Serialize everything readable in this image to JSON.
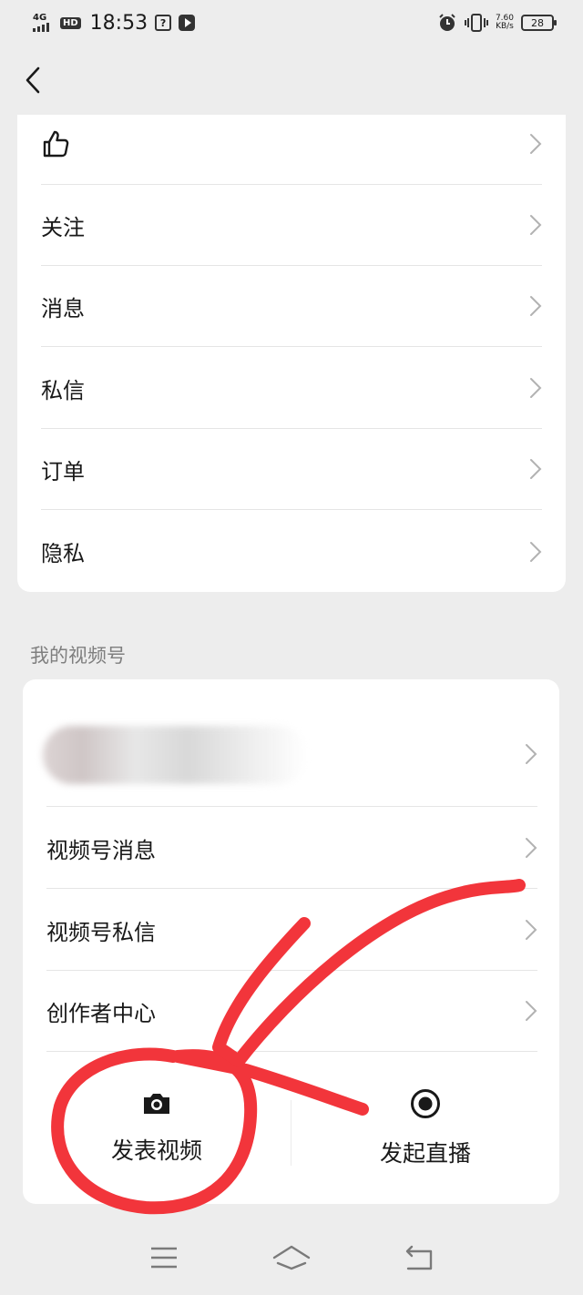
{
  "status_bar": {
    "network": "4G",
    "hd": "HD",
    "time": "18:53",
    "speed_value": "7.60",
    "speed_unit": "KB/s",
    "battery": "28"
  },
  "menu": {
    "items": [
      {
        "label": "",
        "icon": "thumbs-up-icon"
      },
      {
        "label": "关注"
      },
      {
        "label": "消息"
      },
      {
        "label": "私信"
      },
      {
        "label": "订单"
      },
      {
        "label": "隐私"
      }
    ]
  },
  "video_section": {
    "title": "我的视频号",
    "items": [
      {
        "label": "视频号消息"
      },
      {
        "label": "视频号私信"
      },
      {
        "label": "创作者中心"
      }
    ],
    "actions": [
      {
        "label": "发表视频",
        "icon": "camera-icon"
      },
      {
        "label": "发起直播",
        "icon": "live-record-icon"
      }
    ]
  },
  "colors": {
    "background": "#ededed",
    "card": "#ffffff",
    "annotation": "#f2353b"
  }
}
